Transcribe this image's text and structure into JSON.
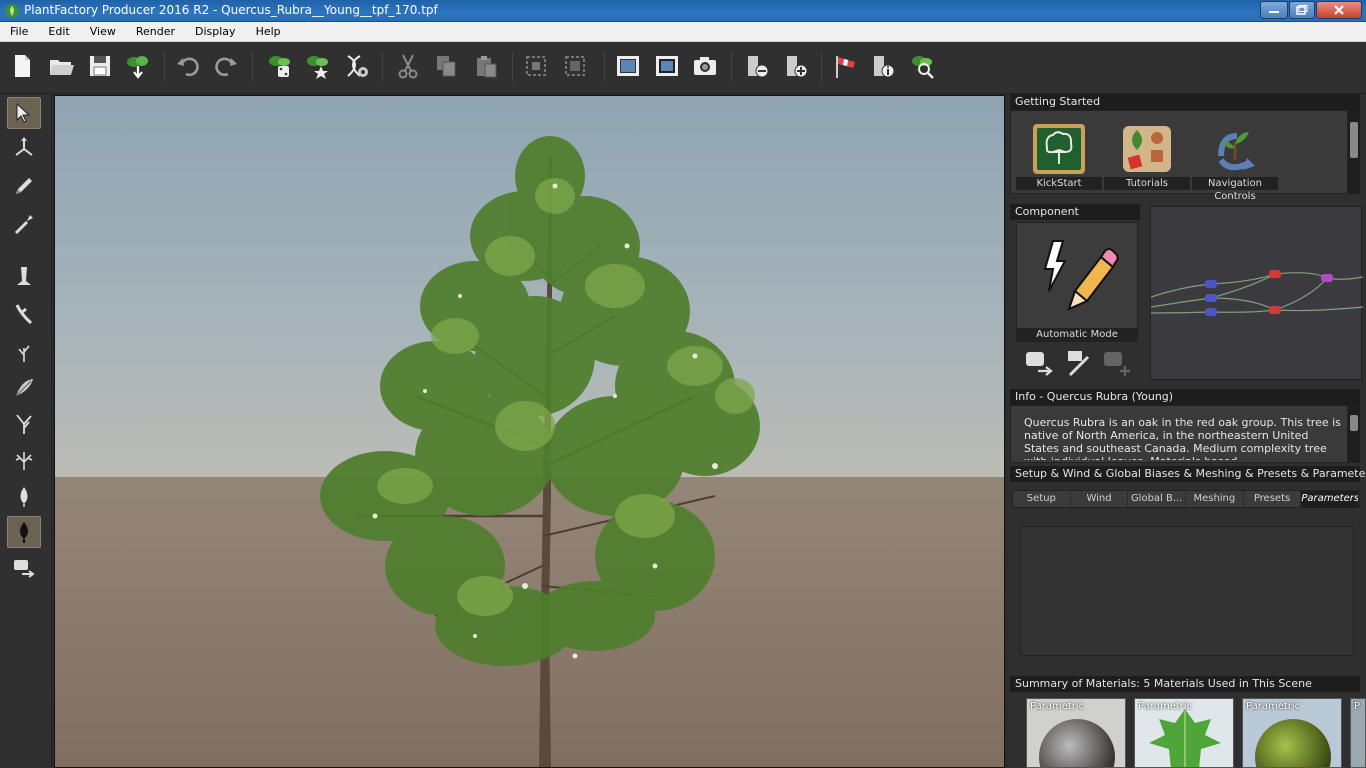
{
  "window": {
    "title": "PlantFactory Producer 2016 R2 - Quercus_Rubra__Young__tpf_170.tpf"
  },
  "menu": [
    {
      "label": "File"
    },
    {
      "label": "Edit"
    },
    {
      "label": "View"
    },
    {
      "label": "Render"
    },
    {
      "label": "Display"
    },
    {
      "label": "Help"
    }
  ],
  "toolbar": {
    "icons": [
      "new-file-icon",
      "open-folder-icon",
      "save-icon",
      "import-plant-icon",
      "undo-icon",
      "redo-icon",
      "random-plant-icon",
      "plant-star-icon",
      "dna-settings-icon",
      "cut-icon",
      "copy-icon",
      "paste-icon",
      "group-icon",
      "ungroup-icon",
      "render-frame-icon",
      "render-region-icon",
      "camera-icon",
      "remove-node-icon",
      "add-node-icon",
      "windsock-icon",
      "node-info-icon",
      "zoom-plant-icon"
    ]
  },
  "left_tools": [
    "select-arrow-icon",
    "move-gizmo-icon",
    "pencil-icon",
    "brush-icon",
    "trunk-icon",
    "branch-icon",
    "twig-icon",
    "frond-icon",
    "fork-icon",
    "shrub-icon",
    "droplet-icon",
    "leaf-icon",
    "node-export-icon"
  ],
  "getting_started": {
    "header": "Getting Started",
    "items": [
      {
        "label": "KickStart",
        "icon": "chalkboard-tree-icon"
      },
      {
        "label": "Tutorials",
        "icon": "tutorials-icon"
      },
      {
        "label": "Navigation Controls",
        "icon": "navigation-controls-icon"
      }
    ]
  },
  "component": {
    "header": "Component",
    "mode_label": "Automatic Mode"
  },
  "info": {
    "header": "Info - Quercus Rubra (Young)",
    "text": "Quercus Rubra is an oak in the red oak group. This tree is native of North America, in the northeastern United States and southeast Canada. Medium complexity tree with individual leaves. Materials based"
  },
  "setup": {
    "header": "Setup & Wind & Global Biases & Meshing & Presets & Parameters",
    "tabs": [
      {
        "label": "Setup",
        "active": false
      },
      {
        "label": "Wind",
        "active": false
      },
      {
        "label": "Global B...",
        "active": false
      },
      {
        "label": "Meshing",
        "active": false
      },
      {
        "label": "Presets",
        "active": false
      },
      {
        "label": "Parameters",
        "active": true
      }
    ]
  },
  "materials": {
    "header": "Summary of Materials: 5 Materials Used in This Scene",
    "items": [
      {
        "label": "Parametric",
        "kind": "bark"
      },
      {
        "label": "Parametric",
        "kind": "leaf"
      },
      {
        "label": "Parametric",
        "kind": "green"
      },
      {
        "label": "P",
        "kind": "partial"
      }
    ]
  },
  "colors": {
    "accent": "#2c75c0",
    "panel": "#2f2f2f",
    "sky": "#a7b4ba",
    "ground": "#8d7d6e"
  }
}
